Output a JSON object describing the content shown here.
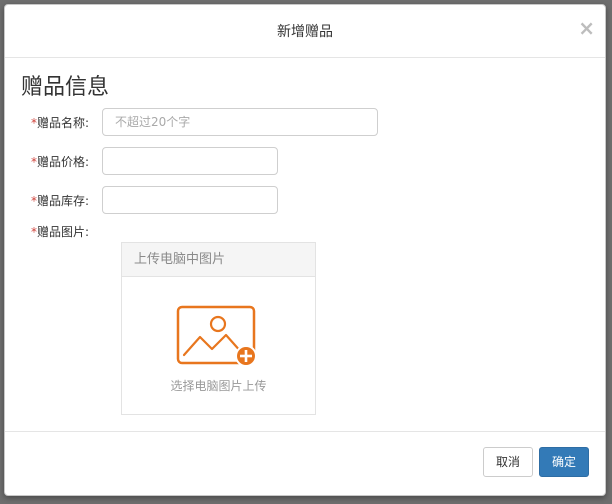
{
  "dialog": {
    "title": "新增赠品",
    "close_symbol": "×"
  },
  "section": {
    "title": "赠品信息"
  },
  "form": {
    "name": {
      "required_mark": "*",
      "label": "赠品名称:",
      "placeholder": "不超过20个字",
      "value": ""
    },
    "price": {
      "required_mark": "*",
      "label": "赠品价格:",
      "value": ""
    },
    "stock": {
      "required_mark": "*",
      "label": "赠品库存:",
      "value": ""
    },
    "image": {
      "required_mark": "*",
      "label": "赠品图片:"
    }
  },
  "upload": {
    "tab_label": "上传电脑中图片",
    "icon": "image-add-icon",
    "caption": "选择电脑图片上传",
    "accent_color": "#e8761e"
  },
  "footer": {
    "cancel_label": "取消",
    "confirm_label": "确定"
  },
  "colors": {
    "primary": "#337ab7",
    "required": "#d0433b"
  }
}
